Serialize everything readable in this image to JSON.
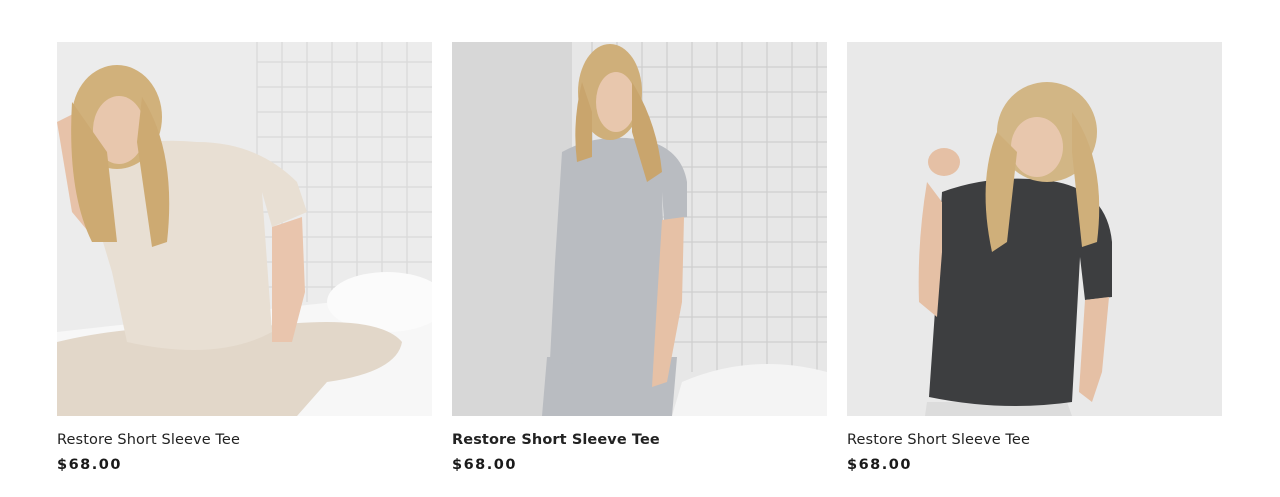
{
  "products": [
    {
      "name": "Restore Short Sleeve Tee",
      "price": "$68.00",
      "tee_color": "#e8dfd3",
      "image_alt": "Woman sitting in beige short sleeve tee"
    },
    {
      "name": "Restore Short Sleeve Tee",
      "price": "$68.00",
      "tee_color": "#b9bcc1",
      "image_alt": "Woman standing in heather grey short sleeve tee"
    },
    {
      "name": "Restore Short Sleeve Tee",
      "price": "$68.00",
      "tee_color": "#3d3e40",
      "image_alt": "Woman in charcoal short sleeve tee"
    }
  ]
}
